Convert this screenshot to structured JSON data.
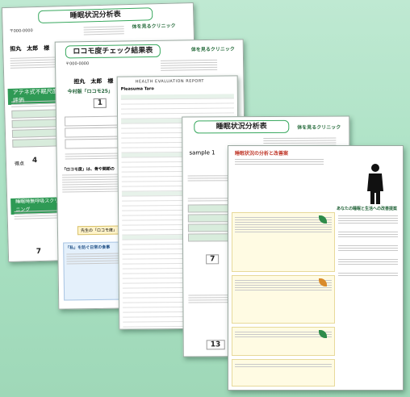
{
  "sheet1": {
    "title": "睡眠状況分析表",
    "postal": "〒000-0000",
    "recipient": "担丸　太郎　様",
    "clinic_logo": "体を見るクリニック",
    "section_a": "アテネ式不眠尺度評価",
    "section_b": "睡眠時無呼吸スクリーニング",
    "score_label": "得点",
    "score_a": "4",
    "score_b": "7"
  },
  "sheet2": {
    "title": "ロコモ度チェック結果表",
    "postal": "〒000-0000",
    "recipient": "担丸　太郎　様",
    "clinic_logo": "体を見るクリニック",
    "subtitle": "今村版「ロコモ25」",
    "result_num": "1",
    "note_head": "「ロコモ度」は、骨や関節の",
    "tips_head": "「私」を防ぐ日常の食事",
    "footer_link": "先生の「ロコモ度」"
  },
  "sheet3": {
    "title": "HEALTH EVALUATION REPORT",
    "col_name": "Pleasuma Taro"
  },
  "sheet4": {
    "title": "睡眠状況分析表",
    "clinic_logo": "体を見るクリニック",
    "recipient": "sample 1",
    "score_a": "7",
    "score_b": "13"
  },
  "sheet5": {
    "title": "睡眠状況の分析と改善案",
    "right_head": "あなたの睡眠と生活への改善提案"
  },
  "colors": {
    "background": "#a8e0c2",
    "accent_green": "#2f9a55",
    "pill_border": "#38a85e"
  }
}
